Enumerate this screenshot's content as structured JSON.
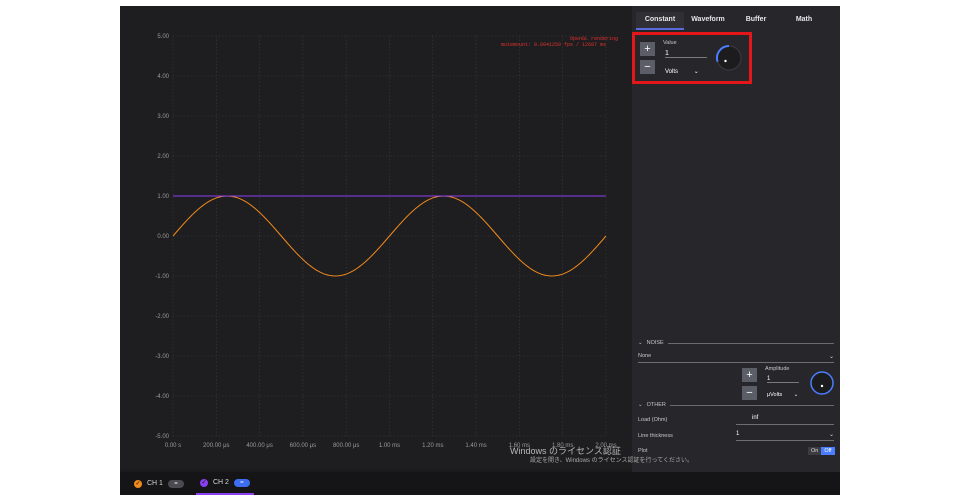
{
  "tabs": [
    {
      "label": "Constant",
      "active": true
    },
    {
      "label": "Waveform",
      "active": false
    },
    {
      "label": "Buffer",
      "active": false
    },
    {
      "label": "Math",
      "active": false
    }
  ],
  "constant": {
    "value_label": "Value",
    "value": "1",
    "unit": "Volts",
    "plus": "+",
    "minus": "−"
  },
  "noise": {
    "section_label": "NOISE",
    "type": "None",
    "amplitude_label": "Amplitude",
    "amplitude": "1",
    "unit": "μVolts",
    "plus": "+",
    "minus": "−"
  },
  "other": {
    "section_label": "OTHER",
    "load_label": "Load (Ohm)",
    "load_value": "inf",
    "line_thickness_label": "Line thickness",
    "line_thickness_value": "1",
    "plot_label": "Plot",
    "toggle_on": "On",
    "toggle_off": "Off"
  },
  "plot": {
    "overlay_line1": "OpenGL rendering",
    "overlay_line2": "mutemount: 0.0041250 fps / 12687 ms",
    "yticks": [
      "5.00",
      "4.00",
      "3.00",
      "2.00",
      "1.00",
      "0.00",
      "-1.00",
      "-2.00",
      "-3.00",
      "-4.00",
      "-5.00"
    ],
    "xticks": [
      "0.00 s",
      "200.00 μs",
      "400.00 μs",
      "600.00 μs",
      "800.00 μs",
      "1.00 ms",
      "1.20 ms",
      "1.40 ms",
      "1.60 ms",
      "1.80 ms",
      "2.00 ms"
    ]
  },
  "channels": [
    {
      "label": "CH 1",
      "color": "#f08a1c",
      "active": false
    },
    {
      "label": "CH 2",
      "color": "#8a3ff0",
      "active": true
    }
  ],
  "watermark": {
    "line1": "Windows のライセンス認証",
    "line2": "設定を開き、Windows のライセンス認証を行ってください。"
  },
  "chart_data": {
    "type": "line",
    "ylim": [
      -5,
      5
    ],
    "x_range_ms": [
      0,
      2.0
    ],
    "series": [
      {
        "color": "#f08a1c",
        "x": [
          0,
          0.25,
          0.5,
          0.75,
          1.0,
          1.25,
          1.5,
          1.75,
          2.0
        ],
        "values": [
          0,
          1,
          0,
          -1,
          0,
          1,
          0,
          -1,
          0
        ]
      },
      {
        "color": "#8a3ff0",
        "x": [
          0,
          2.0
        ],
        "values": [
          1,
          1
        ]
      }
    ]
  }
}
